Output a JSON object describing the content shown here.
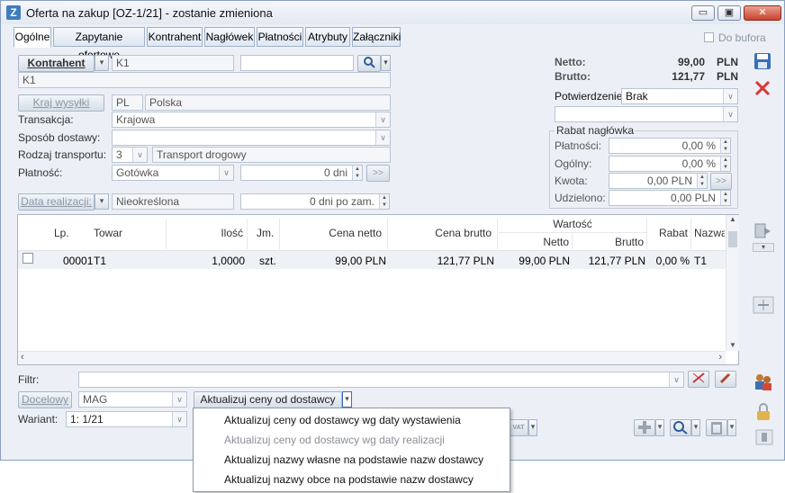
{
  "window": {
    "title": "Oferta na zakup [OZ-1/21] - zostanie zmieniona",
    "app_icon": "Z",
    "controls": {
      "minimize": "▭",
      "maximize": "▣",
      "close": "✕"
    }
  },
  "tabs": [
    "Ogólne",
    "Zapytanie ofertowe",
    "Kontrahent",
    "Nagłówek",
    "Płatności",
    "Atrybuty",
    "Załączniki"
  ],
  "do_bufora": "Do bufora",
  "form": {
    "kontrahent_button": "Kontrahent",
    "kontrahent_code": "K1",
    "kontrahent_name": "K1",
    "kraj_button": "Kraj wysyłki",
    "kraj_code": "PL",
    "kraj_name": "Polska",
    "transakcja_label": "Transakcja:",
    "transakcja_value": "Krajowa",
    "sposob_label": "Sposób dostawy:",
    "sposob_value": "",
    "rodzaj_label": "Rodzaj transportu:",
    "rodzaj_code": "3",
    "rodzaj_value": "Transport drogowy",
    "platnosc_label": "Płatność:",
    "platnosc_value": "Gotówka",
    "platnosc_days": "0 dni",
    "data_button": "Data realizacji:",
    "data_value": "Nieokreślona",
    "data_days": "0 dni po zam."
  },
  "totals": {
    "netto_label": "Netto:",
    "netto_value": "99,00",
    "brutto_label": "Brutto:",
    "brutto_value": "121,77",
    "currency": "PLN",
    "potw_label": "Potwierdzenie:",
    "potw_value": "Brak"
  },
  "rabat": {
    "title": "Rabat nagłówka",
    "platnosci_label": "Płatności:",
    "platnosci_value": "0,00 %",
    "ogolny_label": "Ogólny:",
    "ogolny_value": "0,00 %",
    "kwota_label": "Kwota:",
    "kwota_value": "0,00 PLN",
    "udzielono_label": "Udzielono:",
    "udzielono_value": "0,00 PLN"
  },
  "grid": {
    "headers": {
      "lp": "Lp.",
      "towar": "Towar",
      "ilosc": "Ilość",
      "jm": "Jm.",
      "cena_netto": "Cena netto",
      "cena_brutto": "Cena brutto",
      "wartosc": "Wartość",
      "netto": "Netto",
      "brutto": "Brutto",
      "rabat": "Rabat",
      "nazwa": "Nazwa"
    },
    "row": {
      "lp": "00001",
      "towar": "T1",
      "ilosc": "1,0000",
      "jm": "szt.",
      "cena_netto": "99,00 PLN",
      "cena_brutto": "121,77 PLN",
      "netto": "99,00 PLN",
      "brutto": "121,77 PLN",
      "rabat": "0,00 %",
      "nazwa": "T1"
    }
  },
  "bottom": {
    "filtr_label": "Filtr:",
    "docelowy_button": "Docelowy",
    "magazyn": "MAG",
    "aktualizuj_button": "Aktualizuj ceny od dostawcy",
    "wariant_label": "Wariant:",
    "wariant_value": "1:  1/21",
    "vat_label": "VAT"
  },
  "menu": [
    {
      "label": "Aktualizuj ceny od dostawcy wg daty wystawienia",
      "enabled": true
    },
    {
      "label": "Aktualizuj ceny od dostawcy wg daty realizacji",
      "enabled": false
    },
    {
      "label": "Aktualizuj nazwy własne na podstawie nazw dostawcy",
      "enabled": true
    },
    {
      "label": "Aktualizuj nazwy obce na podstawie nazw dostawcy",
      "enabled": true
    }
  ]
}
